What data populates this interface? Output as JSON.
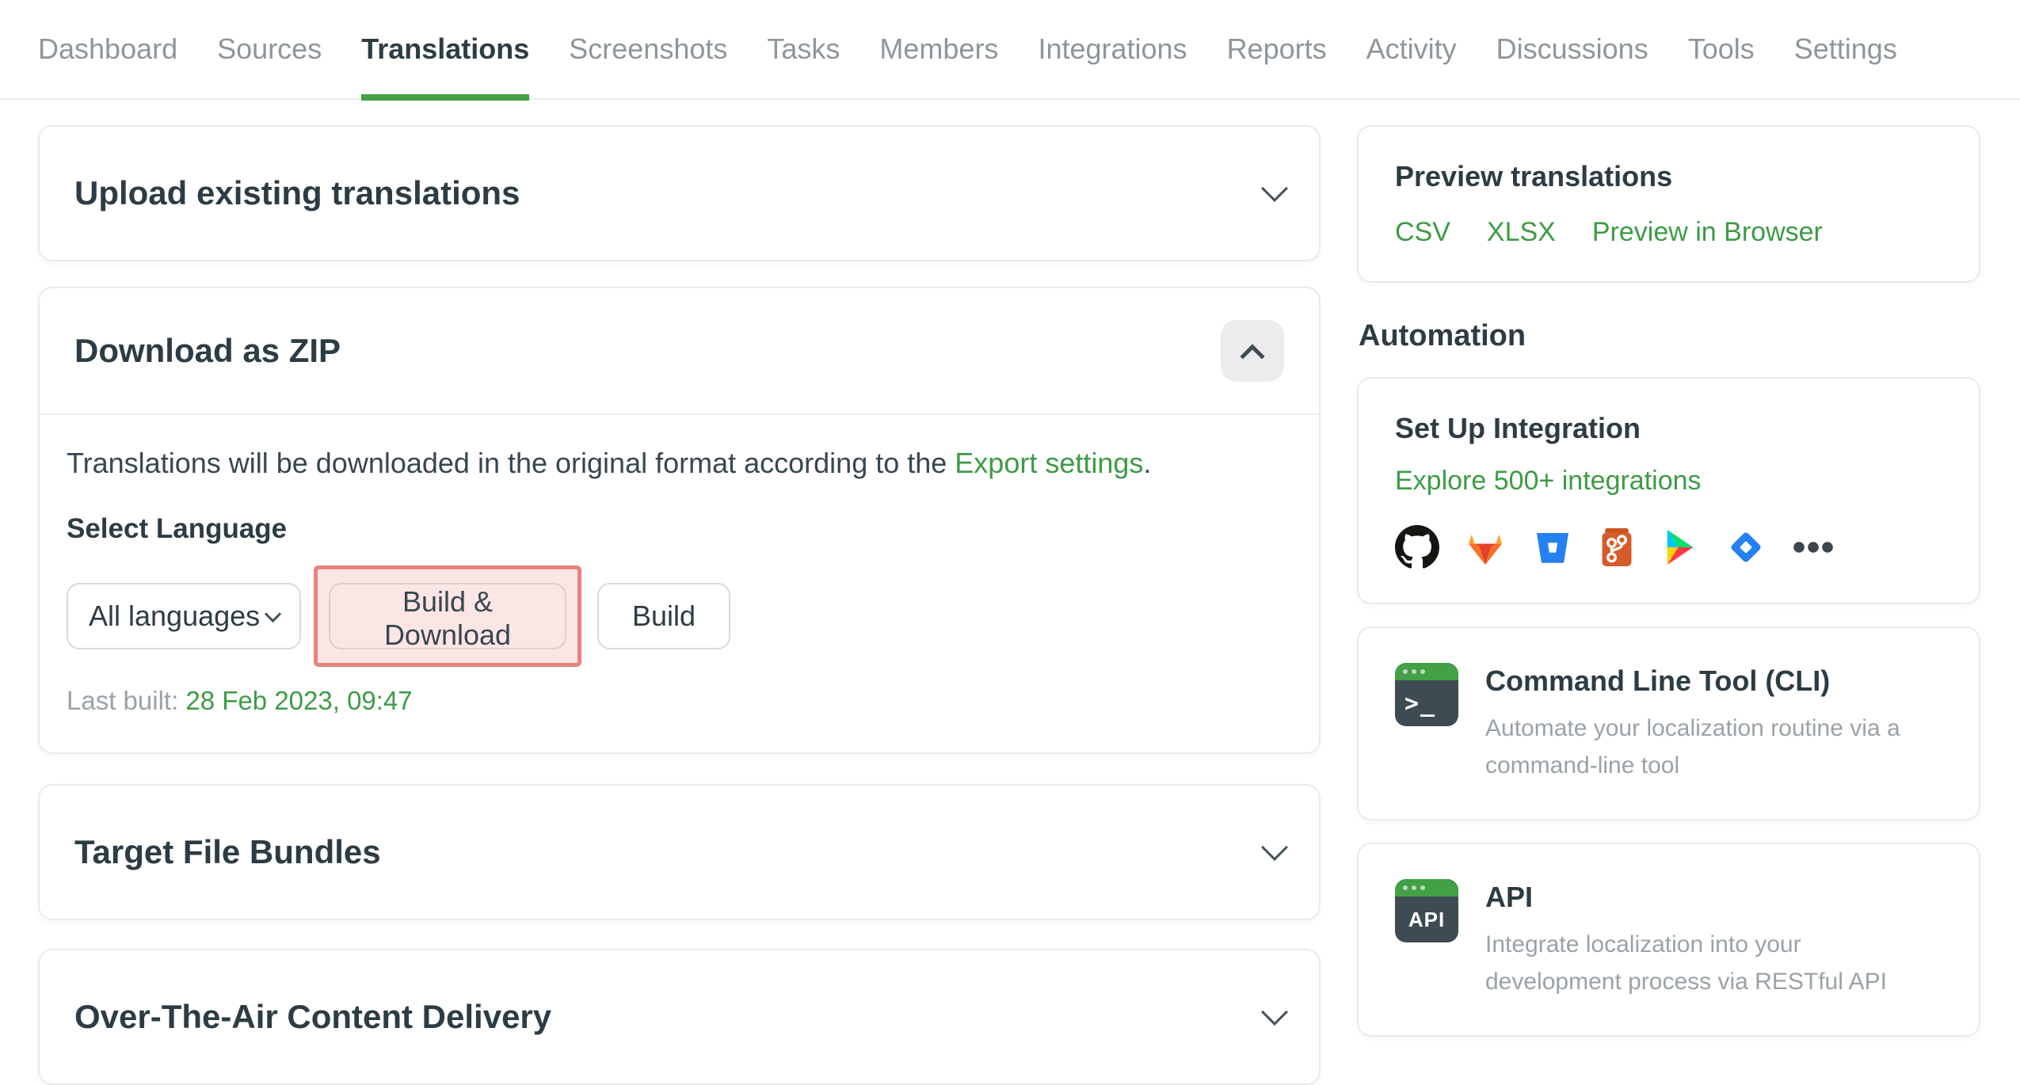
{
  "nav": {
    "tabs": [
      "Dashboard",
      "Sources",
      "Translations",
      "Screenshots",
      "Tasks",
      "Members",
      "Integrations",
      "Reports",
      "Activity",
      "Discussions",
      "Tools",
      "Settings"
    ],
    "active_tab": "Translations"
  },
  "main": {
    "upload_panel": {
      "title": "Upload existing translations"
    },
    "download_panel": {
      "title": "Download as ZIP",
      "description_prefix": "Translations will be downloaded in the original format according to the ",
      "export_settings_link": "Export settings",
      "description_suffix": ".",
      "select_language_label": "Select Language",
      "language_select_value": "All languages",
      "build_and_download_button": "Build & Download",
      "build_button": "Build",
      "last_built_label": "Last built:",
      "last_built_value": "28 Feb 2023, 09:47"
    },
    "bundles_panel": {
      "title": "Target File Bundles"
    },
    "ota_panel": {
      "title": "Over-The-Air Content Delivery"
    }
  },
  "sidebar": {
    "preview_card": {
      "title": "Preview translations",
      "links": [
        "CSV",
        "XLSX",
        "Preview in Browser"
      ]
    },
    "automation_heading": "Automation",
    "integration_card": {
      "title": "Set Up Integration",
      "explore_link": "Explore 500+ integrations",
      "icons": [
        "github",
        "gitlab",
        "bitbucket",
        "git",
        "google-play",
        "jira",
        "more"
      ]
    },
    "cli_card": {
      "title": "Command Line Tool (CLI)",
      "description": "Automate your localization routine via a command-line tool",
      "icon_glyph": ">_"
    },
    "api_card": {
      "title": "API",
      "description": "Integrate localization into your development process via RESTful API",
      "icon_glyph": "API"
    }
  },
  "colors": {
    "accent_green": "#43a047",
    "link_green": "#3d9b45",
    "annotation_border": "#e8837d",
    "annotation_fill": "#fbe6e5"
  }
}
